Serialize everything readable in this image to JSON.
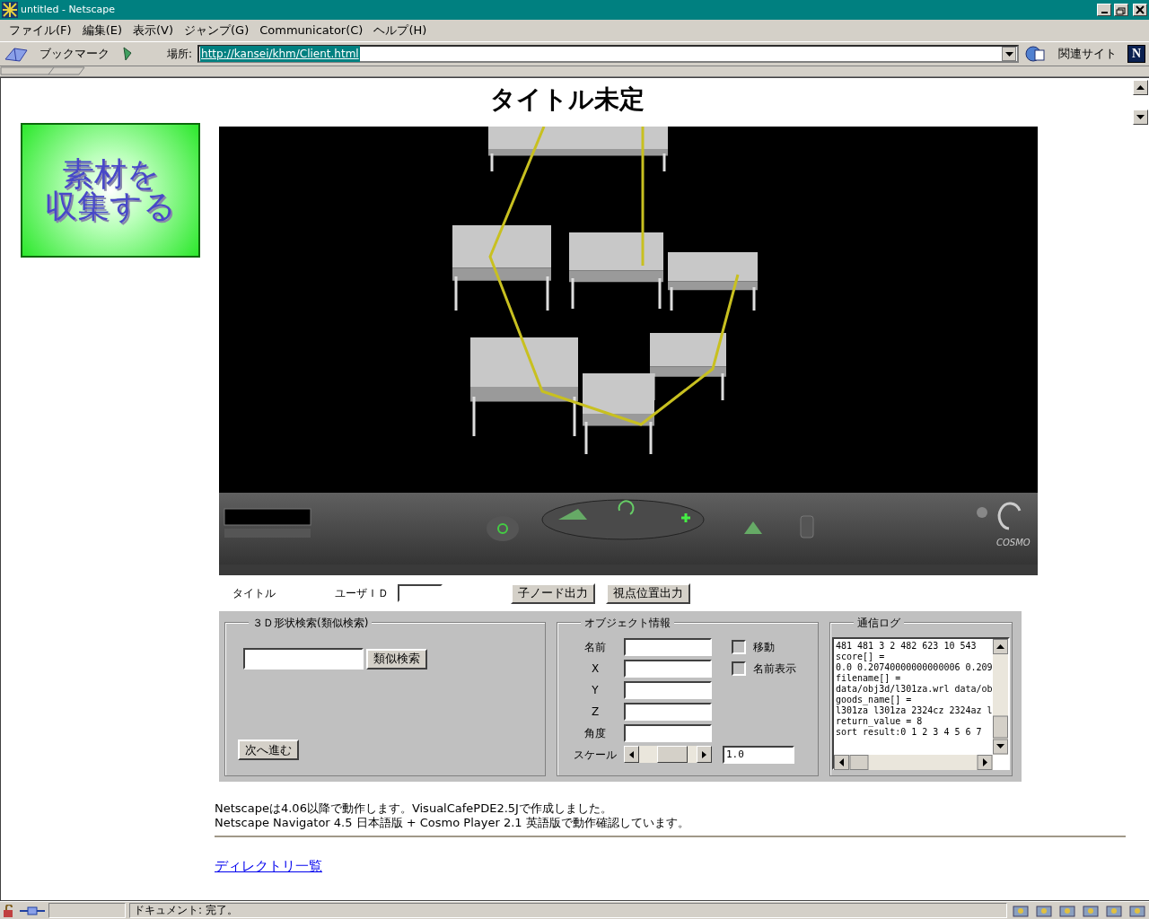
{
  "window": {
    "title": "untitled - Netscape"
  },
  "menu": [
    "ファイル(F)",
    "編集(E)",
    "表示(V)",
    "ジャンプ(G)",
    "Communicator(C)",
    "ヘルプ(H)"
  ],
  "toolbar": {
    "bookmarks": "ブックマーク",
    "location_label": "場所:",
    "url": "http://kansei/khm/Client.html",
    "related": "関連サイト",
    "logo": "N"
  },
  "page": {
    "heading": "タイトル未定",
    "banner": {
      "lines": [
        "素材を",
        "収集する"
      ]
    },
    "viewer": {
      "brand": "COSMO"
    },
    "controls_row": {
      "title_label": "タイトル",
      "user_id_label": "ユーザＩＤ",
      "buttons": [
        "子ノード出力",
        "視点位置出力"
      ]
    },
    "search_group": {
      "legend": "３Ｄ形状検索(類似検索)",
      "search_button": "類似検索",
      "next_button": "次へ進む"
    },
    "object_group": {
      "legend": "オブジェクト情報",
      "fields": [
        {
          "label": "名前"
        },
        {
          "label": "X"
        },
        {
          "label": "Y"
        },
        {
          "label": "Z"
        },
        {
          "label": "角度"
        }
      ],
      "checkboxes": [
        {
          "label": "移動",
          "checked": false
        },
        {
          "label": "名前表示",
          "checked": false
        }
      ],
      "scale": {
        "label": "スケール",
        "level": 0.55,
        "value": "1.0"
      }
    },
    "log_group": {
      "legend": "通信ログ",
      "lines": [
        "481 481 3 2 482 623 10 543",
        "score[] =",
        "0.0 0.20740000000000006 0.209",
        "filename[] =",
        "data/obj3d/l301za.wrl data/ob",
        "goods_name[] =",
        "l301za l301za 2324cz 2324az l",
        "return_value = 8",
        "sort result:0 1 2 3 4 5 6 7"
      ]
    },
    "notes": [
      "Netscapeは4.06以降で動作します。VisualCafePDE2.5Jで作成しました。",
      "Netscape Navigator 4.5 日本語版 + Cosmo Player 2.1 英語版で動作確認しています。"
    ],
    "link": "ディレクトリ一覧"
  },
  "status_bar": {
    "text": "ドキュメント: 完了。"
  }
}
